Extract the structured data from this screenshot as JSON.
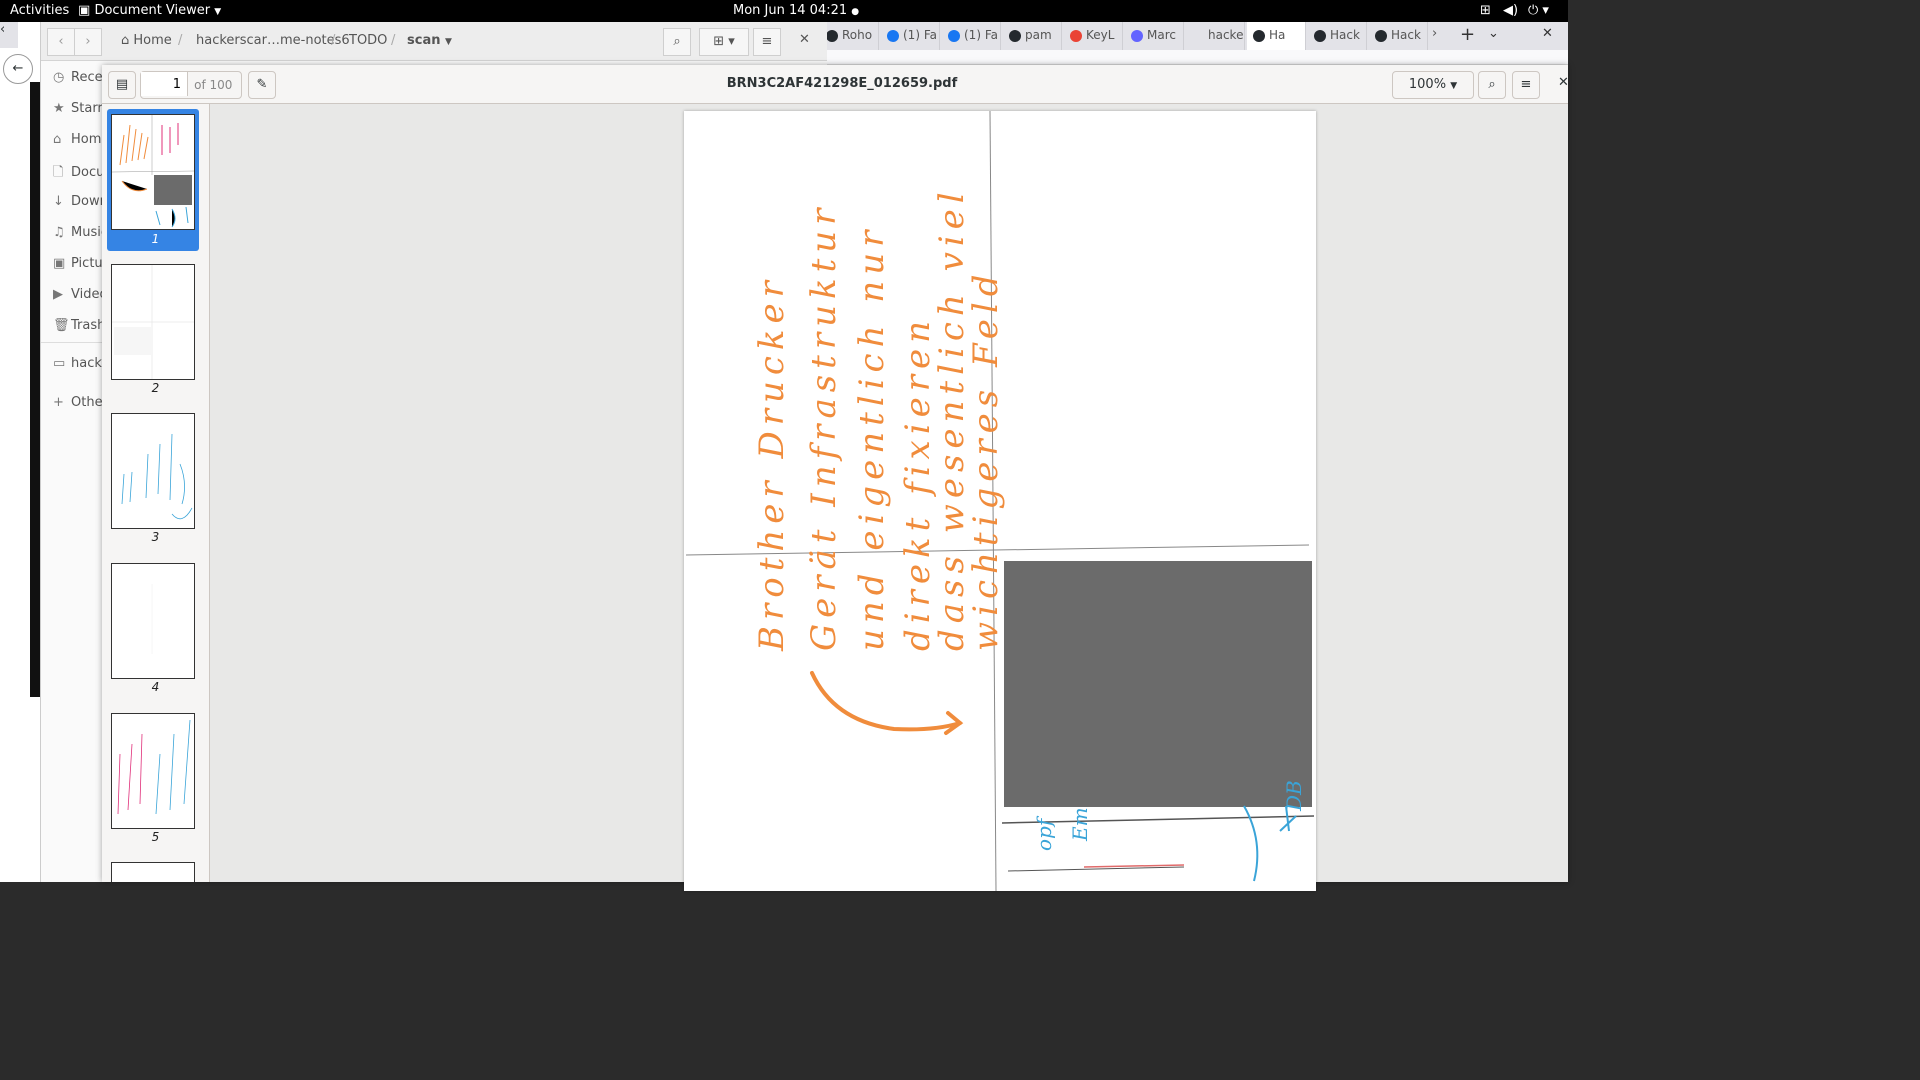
{
  "topbar": {
    "activities": "Activities",
    "app_name": "Document Viewer",
    "clock": "Mon Jun 14  04:21",
    "icons": [
      "network-icon",
      "volume-icon",
      "power-icon"
    ]
  },
  "browser": {
    "tabs": [
      {
        "label": "Roho",
        "icon": "github-icon"
      },
      {
        "label": "(1) Fa",
        "icon": "facebook-icon"
      },
      {
        "label": "(1) Fa",
        "icon": "facebook-icon"
      },
      {
        "label": "pam",
        "icon": "github-icon"
      },
      {
        "label": "KeyL",
        "icon": "google-icon"
      },
      {
        "label": "Marc",
        "icon": "mastodon-icon"
      },
      {
        "label": "hackers",
        "icon": ""
      },
      {
        "label": "Ha",
        "icon": "github-icon"
      },
      {
        "label": "Hack",
        "icon": "github-icon"
      },
      {
        "label": "Hack",
        "icon": "github-icon"
      }
    ]
  },
  "files": {
    "breadcrumbs": [
      "Home",
      "hackerscar…me-notes6",
      "TODO",
      "scan"
    ],
    "sidebar": [
      "Recent",
      "Starred",
      "Home",
      "Documents",
      "Downloads",
      "Music",
      "Pictures",
      "Videos",
      "Trash",
      "hackerscar",
      "Other Locations"
    ]
  },
  "viewer": {
    "page_number": "1",
    "page_total": "of 100",
    "filename": "BRN3C2AF421298E_012659.pdf",
    "zoom": "100%",
    "thumbnails": [
      "1",
      "2",
      "3",
      "4",
      "5"
    ],
    "selected_thumbnail": "1"
  },
  "handwriting": {
    "lines": [
      "Brother Drucker",
      "Gerät Infrastruktur",
      "und eigentlich nur",
      "direkt fixieren",
      "dass wesentlich viel",
      "wichtigeres Feld"
    ],
    "bottom_fragments": [
      "opf",
      "Em",
      "DB"
    ],
    "colors": {
      "orange": "#f08c3c",
      "blue": "#3aa4d8",
      "gray_block": "#6b6b6b"
    }
  }
}
